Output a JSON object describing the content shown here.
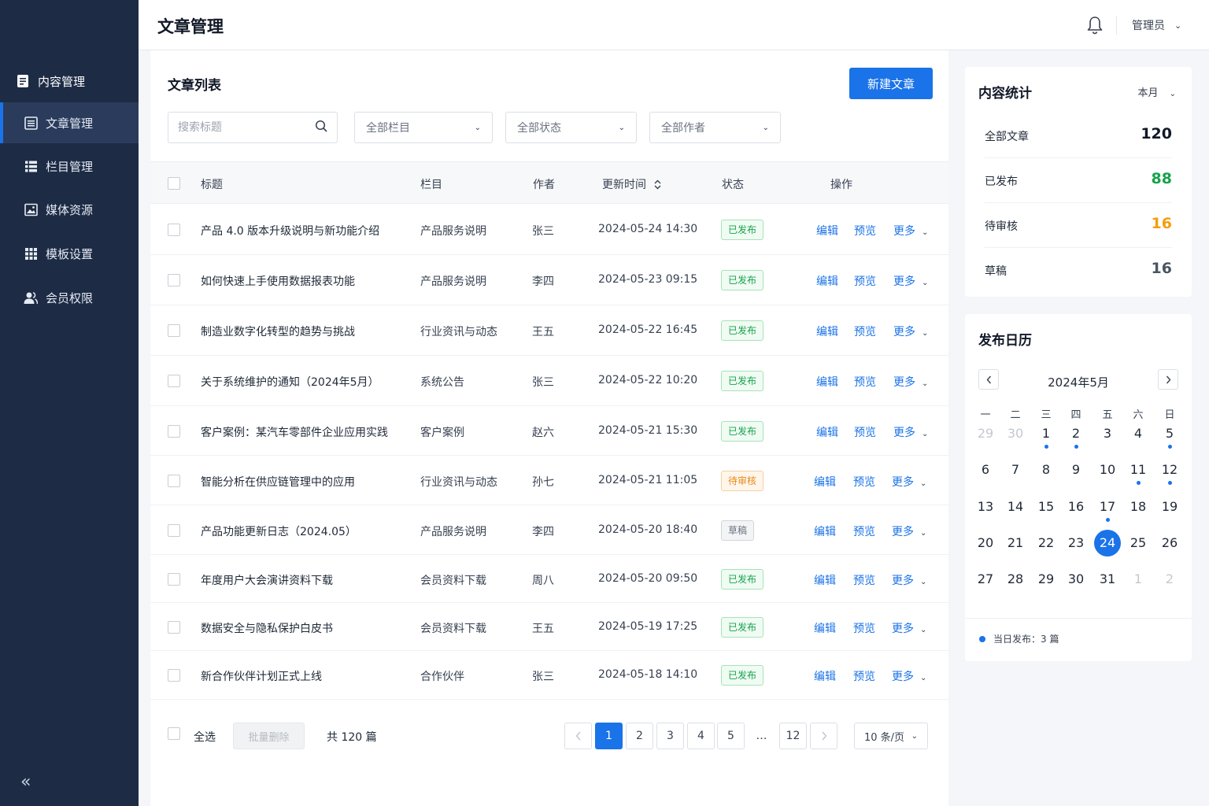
{
  "sidebar": {
    "group_label": "内容管理",
    "items": [
      {
        "label": "文章管理",
        "icon": "article-icon",
        "active": true
      },
      {
        "label": "栏目管理",
        "icon": "list-icon",
        "active": false
      },
      {
        "label": "媒体资源",
        "icon": "image-icon",
        "active": false
      },
      {
        "label": "模板设置",
        "icon": "grid-icon",
        "active": false
      },
      {
        "label": "会员权限",
        "icon": "users-icon",
        "active": false
      }
    ],
    "collapse_glyph": "«"
  },
  "header": {
    "title": "文章管理",
    "user": "管理员"
  },
  "list": {
    "title": "文章列表",
    "new_button": "新建文章",
    "search_placeholder": "搜索标题",
    "filters": [
      "全部栏目",
      "全部状态",
      "全部作者"
    ],
    "columns": {
      "title": "标题",
      "category": "栏目",
      "author": "作者",
      "updated": "更新时间",
      "status": "状态",
      "actions": "操作"
    },
    "action_labels": {
      "edit": "编辑",
      "preview": "预览",
      "more": "更多"
    },
    "rows": [
      {
        "title": "产品 4.0 版本升级说明与新功能介绍",
        "category": "产品服务说明",
        "author": "张三",
        "updated": "2024-05-24 14:30",
        "status": "已发布",
        "status_type": "published"
      },
      {
        "title": "如何快速上手使用数据报表功能",
        "category": "产品服务说明",
        "author": "李四",
        "updated": "2024-05-23 09:15",
        "status": "已发布",
        "status_type": "published"
      },
      {
        "title": "制造业数字化转型的趋势与挑战",
        "category": "行业资讯与动态",
        "author": "王五",
        "updated": "2024-05-22 16:45",
        "status": "已发布",
        "status_type": "published"
      },
      {
        "title": "关于系统维护的通知（2024年5月）",
        "category": "系统公告",
        "author": "张三",
        "updated": "2024-05-22 10:20",
        "status": "已发布",
        "status_type": "published"
      },
      {
        "title": "客户案例：某汽车零部件企业应用实践",
        "category": "客户案例",
        "author": "赵六",
        "updated": "2024-05-21 15:30",
        "status": "已发布",
        "status_type": "published"
      },
      {
        "title": "智能分析在供应链管理中的应用",
        "category": "行业资讯与动态",
        "author": "孙七",
        "updated": "2024-05-21 11:05",
        "status": "待审核",
        "status_type": "pending"
      },
      {
        "title": "产品功能更新日志（2024.05）",
        "category": "产品服务说明",
        "author": "李四",
        "updated": "2024-05-20 18:40",
        "status": "草稿",
        "status_type": "draft"
      },
      {
        "title": "年度用户大会演讲资料下载",
        "category": "会员资料下载",
        "author": "周八",
        "updated": "2024-05-20 09:50",
        "status": "已发布",
        "status_type": "published"
      },
      {
        "title": "数据安全与隐私保护白皮书",
        "category": "会员资料下载",
        "author": "王五",
        "updated": "2024-05-19 17:25",
        "status": "已发布",
        "status_type": "published"
      },
      {
        "title": "新合作伙伴计划正式上线",
        "category": "合作伙伴",
        "author": "张三",
        "updated": "2024-05-18 14:10",
        "status": "已发布",
        "status_type": "published"
      }
    ],
    "footer": {
      "select_all": "全选",
      "batch_delete": "批量删除",
      "total": "共 120 篇",
      "pages": [
        "1",
        "2",
        "3",
        "4",
        "5",
        "…",
        "12"
      ],
      "current_page": "1",
      "page_size": "10 条/页"
    }
  },
  "stats": {
    "title": "内容统计",
    "period": "本月",
    "items": [
      {
        "label": "全部文章",
        "value": "120",
        "color": "#111827"
      },
      {
        "label": "已发布",
        "value": "88",
        "color": "#16a34a"
      },
      {
        "label": "待审核",
        "value": "16",
        "color": "#f59e0b"
      },
      {
        "label": "草稿",
        "value": "16",
        "color": "#4b5563"
      }
    ]
  },
  "calendar": {
    "title": "发布日历",
    "month": "2024年5月",
    "weekdays": [
      "一",
      "二",
      "三",
      "四",
      "五",
      "六",
      "日"
    ],
    "weeks": [
      [
        "29",
        "30",
        "1",
        "2",
        "3",
        "4",
        "5"
      ],
      [
        "6",
        "7",
        "8",
        "9",
        "10",
        "11",
        "12"
      ],
      [
        "13",
        "14",
        "15",
        "16",
        "17",
        "18",
        "19"
      ],
      [
        "20",
        "21",
        "22",
        "23",
        "24",
        "25",
        "26"
      ],
      [
        "27",
        "28",
        "29",
        "30",
        "31",
        "1",
        "2"
      ]
    ],
    "selected": "24",
    "days_with_posts": [
      "1",
      "2",
      "5",
      "11",
      "12",
      "17"
    ],
    "legend": "当日发布：3 篇",
    "accent": "#1a73e8"
  },
  "colors": {
    "sidebar_bg": "#1d2b45",
    "accent": "#1a73e8"
  }
}
